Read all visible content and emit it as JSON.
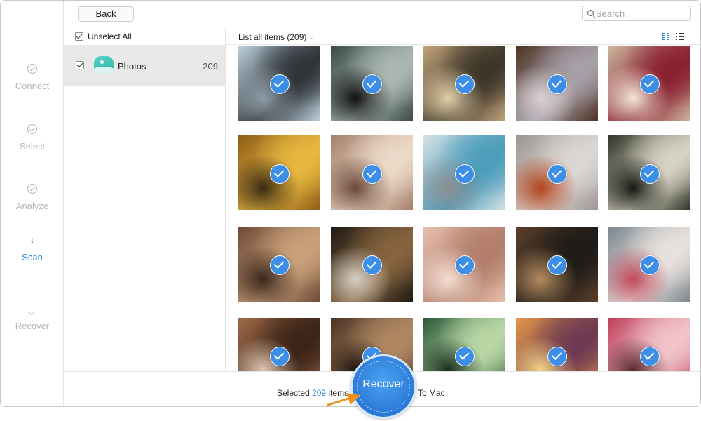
{
  "window": {
    "title": ""
  },
  "steps": [
    {
      "label": "Connect",
      "state": "done"
    },
    {
      "label": "Select",
      "state": "done"
    },
    {
      "label": "Analyze",
      "state": "done"
    },
    {
      "label": "Scan",
      "state": "active"
    },
    {
      "label": "Recover",
      "state": "pending"
    }
  ],
  "toolbar": {
    "back_label": "Back",
    "search_placeholder": "Search"
  },
  "categories": {
    "unselect_label": "Unselect All",
    "items": [
      {
        "label": "Photos",
        "count": "209",
        "checked": true
      }
    ]
  },
  "grid_header": {
    "list_label": "List all items (209)",
    "chevron": "⌄"
  },
  "photos": [
    {
      "name": "vintage-car-1",
      "colors": [
        "#bcd0dd",
        "#2f3438",
        "#8d9aa4"
      ],
      "checked": true
    },
    {
      "name": "vintage-car-2",
      "colors": [
        "#394a43",
        "#aab7b2",
        "#121212"
      ],
      "checked": true
    },
    {
      "name": "vintage-camera-lens",
      "colors": [
        "#c2a47a",
        "#3d3528",
        "#e2cfa8"
      ],
      "checked": true
    },
    {
      "name": "cupcake-chocolate",
      "colors": [
        "#4d3223",
        "#a7a0a8",
        "#d8d0d4"
      ],
      "checked": true
    },
    {
      "name": "cupcake-cream",
      "colors": [
        "#cbb59d",
        "#8a2030",
        "#f1e6d8"
      ],
      "checked": true
    },
    {
      "name": "gramophone",
      "colors": [
        "#8c5d17",
        "#e7b73f",
        "#3b2a14"
      ],
      "checked": true
    },
    {
      "name": "miniature-brick-wall",
      "colors": [
        "#a57f6a",
        "#ecd9c8",
        "#6d4a3a"
      ],
      "checked": true
    },
    {
      "name": "blue-book-stack",
      "colors": [
        "#d6e0e3",
        "#4b9dbb",
        "#8b8f91"
      ],
      "checked": true
    },
    {
      "name": "physalis-on-wood",
      "colors": [
        "#9c9591",
        "#dcd6d2",
        "#b3431c"
      ],
      "checked": true
    },
    {
      "name": "dried-leaf",
      "colors": [
        "#2f3428",
        "#d7d2c2",
        "#171a13"
      ],
      "checked": true
    },
    {
      "name": "antique-room",
      "colors": [
        "#6d4a38",
        "#c9a07a",
        "#3a271c"
      ],
      "checked": true
    },
    {
      "name": "kitchen-table",
      "colors": [
        "#1e1914",
        "#87643e",
        "#d6cfc4"
      ],
      "checked": true
    },
    {
      "name": "baby-hands",
      "colors": [
        "#e5c0ad",
        "#b47e6c",
        "#f4dfd3"
      ],
      "checked": true
    },
    {
      "name": "old-camera",
      "colors": [
        "#5a3f2a",
        "#1f1b18",
        "#b48b5e"
      ],
      "checked": true
    },
    {
      "name": "toy-dog",
      "colors": [
        "#7c8790",
        "#e8e1dc",
        "#c24b5d"
      ],
      "checked": true
    },
    {
      "name": "violin",
      "colors": [
        "#a06a48",
        "#3b2418",
        "#e1c7b2"
      ],
      "checked": true
    },
    {
      "name": "clay-hands",
      "colors": [
        "#4a3324",
        "#b08762",
        "#1c140e"
      ],
      "checked": true
    },
    {
      "name": "bamboo",
      "colors": [
        "#2c5a3a",
        "#b9d8a5",
        "#172c1e"
      ],
      "checked": true
    },
    {
      "name": "tulip-field-sunset",
      "colors": [
        "#e49848",
        "#6e3a52",
        "#f3d486"
      ],
      "checked": true
    },
    {
      "name": "plumeria-flowers",
      "colors": [
        "#c0405d",
        "#f1c4c9",
        "#5a2a33"
      ],
      "checked": true
    }
  ],
  "bottom": {
    "selected_prefix": "Selected",
    "selected_count": "209",
    "selected_suffix": "items",
    "recover_label": "Recover",
    "destination": "To Mac"
  },
  "colors": {
    "accent": "#2f86db",
    "check_badge": "#3c8ee6",
    "pointer": "#f0901e"
  }
}
